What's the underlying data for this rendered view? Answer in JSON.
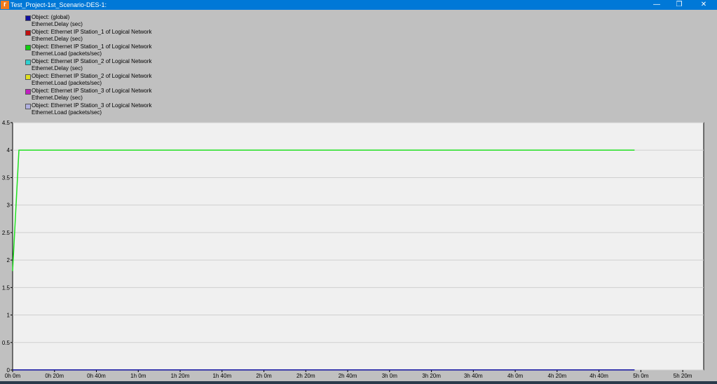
{
  "window": {
    "title": "Test_Project-1st_Scenario-DES-1:",
    "app_icon_glyph": "r",
    "minimize_glyph": "—",
    "maximize_glyph": "❐",
    "close_glyph": "✕"
  },
  "legend": [
    {
      "object": "Object: (global)",
      "stat": "Ethernet.Delay (sec)",
      "color": "#1010a0"
    },
    {
      "object": "Object: Ethernet IP Station_1 of Logical Network",
      "stat": "Ethernet.Delay (sec)",
      "color": "#c01010"
    },
    {
      "object": "Object: Ethernet IP Station_1 of Logical Network",
      "stat": "Ethernet.Load (packets/sec)",
      "color": "#10d010"
    },
    {
      "object": "Object: Ethernet IP Station_2 of Logical Network",
      "stat": "Ethernet.Delay (sec)",
      "color": "#30d0d0"
    },
    {
      "object": "Object: Ethernet IP Station_2 of Logical Network",
      "stat": "Ethernet.Load (packets/sec)",
      "color": "#e0e020"
    },
    {
      "object": "Object: Ethernet IP Station_3 of Logical Network",
      "stat": "Ethernet.Delay (sec)",
      "color": "#c020c0"
    },
    {
      "object": "Object: Ethernet IP Station_3 of Logical Network",
      "stat": "Ethernet.Load (packets/sec)",
      "color": "#b0b0e0"
    }
  ],
  "chart_data": {
    "type": "line",
    "title": "",
    "xlabel": "",
    "ylabel": "",
    "xlim_minutes": [
      0,
      330
    ],
    "ylim": [
      0,
      4.5
    ],
    "grid": true,
    "x_ticks": [
      {
        "minutes": 0,
        "label": "0h 0m"
      },
      {
        "minutes": 20,
        "label": "0h 20m"
      },
      {
        "minutes": 40,
        "label": "0h 40m"
      },
      {
        "minutes": 60,
        "label": "1h 0m"
      },
      {
        "minutes": 80,
        "label": "1h 20m"
      },
      {
        "minutes": 100,
        "label": "1h 40m"
      },
      {
        "minutes": 120,
        "label": "2h 0m"
      },
      {
        "minutes": 140,
        "label": "2h 20m"
      },
      {
        "minutes": 160,
        "label": "2h 40m"
      },
      {
        "minutes": 180,
        "label": "3h 0m"
      },
      {
        "minutes": 200,
        "label": "3h 20m"
      },
      {
        "minutes": 220,
        "label": "3h 40m"
      },
      {
        "minutes": 240,
        "label": "4h 0m"
      },
      {
        "minutes": 260,
        "label": "4h 20m"
      },
      {
        "minutes": 280,
        "label": "4h 40m"
      },
      {
        "minutes": 300,
        "label": "5h 0m"
      },
      {
        "minutes": 320,
        "label": "5h 20m"
      }
    ],
    "y_ticks": [
      {
        "value": 0,
        "label": "0"
      },
      {
        "value": 0.5,
        "label": "0.5"
      },
      {
        "value": 1,
        "label": "1"
      },
      {
        "value": 1.5,
        "label": "1.5"
      },
      {
        "value": 2,
        "label": "2"
      },
      {
        "value": 2.5,
        "label": "2.5"
      },
      {
        "value": 3,
        "label": "3"
      },
      {
        "value": 3.5,
        "label": "3.5"
      },
      {
        "value": 4,
        "label": "4"
      },
      {
        "value": 4.5,
        "label": "4.5"
      }
    ],
    "series": [
      {
        "color": "#20e020",
        "x_minutes": [
          0,
          3,
          297
        ],
        "y": [
          1.8,
          4,
          4
        ]
      },
      {
        "color": "#1010a0",
        "x_minutes": [
          0,
          297
        ],
        "y": [
          0.001,
          0.001
        ]
      }
    ]
  }
}
